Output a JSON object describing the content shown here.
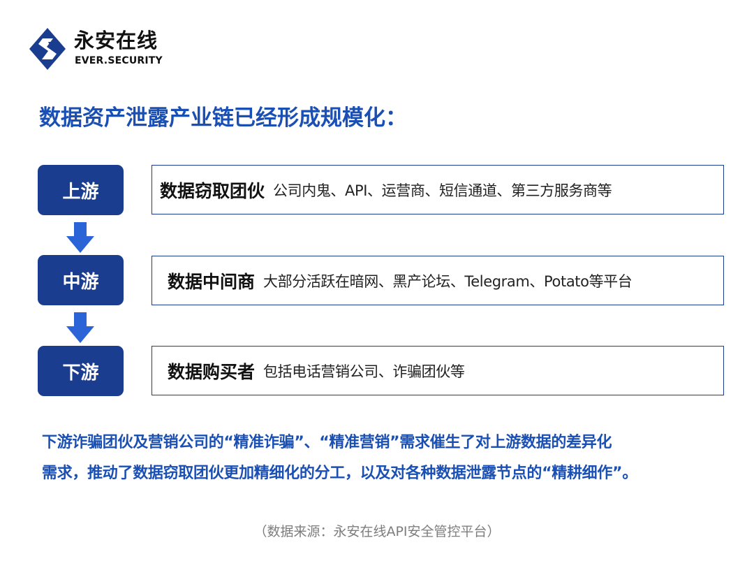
{
  "brand": {
    "name_cn": "永安在线",
    "name_en": "EVER.SECURITY",
    "logo_icon": "s-shield-logo-icon"
  },
  "colors": {
    "primary": "#1a3d8f",
    "accent_text": "#1a4fb4",
    "arrow": "#2a64d6",
    "source_text": "#7d7d7d"
  },
  "heading": "数据资产泄露产业链已经形成规模化：",
  "chain": [
    {
      "stage": "上游",
      "name": "数据窃取团伙",
      "desc": "公司内鬼、API、运营商、短信通道、第三方服务商等"
    },
    {
      "stage": "中游",
      "name": "数据中间商",
      "desc": "大部分活跃在暗网、黑产论坛、Telegram、Potato等平台"
    },
    {
      "stage": "下游",
      "name": "数据购买者",
      "desc": "包括电话营销公司、诈骗团伙等"
    }
  ],
  "summary": {
    "line1": "下游诈骗团伙及营销公司的“精准诈骗”、“精准营销”需求催生了对上游数据的差异化",
    "line2": "需求，推动了数据窃取团伙更加精细化的分工，以及对各种数据泄露节点的“精耕细作”。"
  },
  "source": "（数据来源：永安在线API安全管控平台）"
}
